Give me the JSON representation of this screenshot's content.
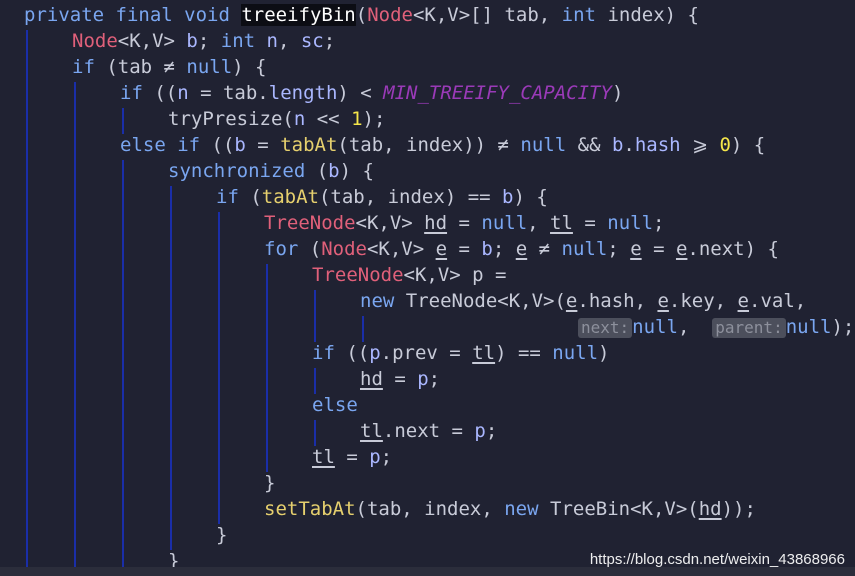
{
  "editor": {
    "language": "Java",
    "colors": {
      "background": "#202232",
      "keyword": "#7aa6f0",
      "type": "#e0607a",
      "method": "#e6d06e",
      "variable": "#aab7ff",
      "number": "#f5e64a",
      "constant": "#9a3ab8",
      "indent_guide": "#1a2ea8"
    },
    "lines": [
      {
        "tokens": [
          {
            "t": "private final void ",
            "c": "kw"
          },
          {
            "t": "treeifyBin",
            "c": "sel"
          },
          {
            "t": "(",
            "c": "plain"
          },
          {
            "t": "Node",
            "c": "tp"
          },
          {
            "t": "<K,V>[] tab, ",
            "c": "plain"
          },
          {
            "t": "int ",
            "c": "kw"
          },
          {
            "t": "index) {",
            "c": "plain"
          }
        ]
      },
      {
        "tokens": [
          {
            "t": "Node",
            "c": "tp"
          },
          {
            "t": "<K,V> ",
            "c": "plain"
          },
          {
            "t": "b",
            "c": "vr"
          },
          {
            "t": "; ",
            "c": "plain"
          },
          {
            "t": "int ",
            "c": "kw"
          },
          {
            "t": "n",
            "c": "vr"
          },
          {
            "t": ", ",
            "c": "plain"
          },
          {
            "t": "sc",
            "c": "vr"
          },
          {
            "t": ";",
            "c": "plain"
          }
        ]
      },
      {
        "tokens": [
          {
            "t": "if ",
            "c": "kw"
          },
          {
            "t": "(tab ≠ ",
            "c": "plain"
          },
          {
            "t": "null",
            "c": "kw"
          },
          {
            "t": ") {",
            "c": "plain"
          }
        ]
      },
      {
        "tokens": [
          {
            "t": "if ",
            "c": "kw"
          },
          {
            "t": "((",
            "c": "plain"
          },
          {
            "t": "n",
            "c": "vr"
          },
          {
            "t": " = tab.",
            "c": "plain"
          },
          {
            "t": "length",
            "c": "vr"
          },
          {
            "t": ") < ",
            "c": "plain"
          },
          {
            "t": "MIN_TREEIFY_CAPACITY",
            "c": "cst"
          },
          {
            "t": ")",
            "c": "plain"
          }
        ]
      },
      {
        "tokens": [
          {
            "t": "tryPresize(",
            "c": "plain"
          },
          {
            "t": "n",
            "c": "vr"
          },
          {
            "t": " << ",
            "c": "plain"
          },
          {
            "t": "1",
            "c": "num"
          },
          {
            "t": ");",
            "c": "plain"
          }
        ]
      },
      {
        "tokens": [
          {
            "t": "else if ",
            "c": "kw"
          },
          {
            "t": "((",
            "c": "plain"
          },
          {
            "t": "b",
            "c": "vr"
          },
          {
            "t": " = ",
            "c": "plain"
          },
          {
            "t": "tabAt",
            "c": "fn"
          },
          {
            "t": "(tab, index)) ≠ ",
            "c": "plain"
          },
          {
            "t": "null",
            "c": "kw"
          },
          {
            "t": " && ",
            "c": "plain"
          },
          {
            "t": "b",
            "c": "vr"
          },
          {
            "t": ".",
            "c": "plain"
          },
          {
            "t": "hash",
            "c": "vr"
          },
          {
            "t": " ⩾ ",
            "c": "plain"
          },
          {
            "t": "0",
            "c": "num"
          },
          {
            "t": ") {",
            "c": "plain"
          }
        ]
      },
      {
        "tokens": [
          {
            "t": "synchronized ",
            "c": "kw"
          },
          {
            "t": "(",
            "c": "plain"
          },
          {
            "t": "b",
            "c": "vr"
          },
          {
            "t": ") {",
            "c": "plain"
          }
        ]
      },
      {
        "tokens": [
          {
            "t": "if ",
            "c": "kw"
          },
          {
            "t": "(",
            "c": "plain"
          },
          {
            "t": "tabAt",
            "c": "fn"
          },
          {
            "t": "(tab, index) == ",
            "c": "plain"
          },
          {
            "t": "b",
            "c": "vr"
          },
          {
            "t": ") {",
            "c": "plain"
          }
        ]
      },
      {
        "tokens": [
          {
            "t": "TreeNode",
            "c": "tp"
          },
          {
            "t": "<K,V> ",
            "c": "plain"
          },
          {
            "t": "hd",
            "c": "plain",
            "u": true
          },
          {
            "t": " = ",
            "c": "plain"
          },
          {
            "t": "null",
            "c": "kw"
          },
          {
            "t": ", ",
            "c": "plain"
          },
          {
            "t": "tl",
            "c": "plain",
            "u": true
          },
          {
            "t": " = ",
            "c": "plain"
          },
          {
            "t": "null",
            "c": "kw"
          },
          {
            "t": ";",
            "c": "plain"
          }
        ]
      },
      {
        "tokens": [
          {
            "t": "for ",
            "c": "kw"
          },
          {
            "t": "(",
            "c": "plain"
          },
          {
            "t": "Node",
            "c": "tp"
          },
          {
            "t": "<K,V> ",
            "c": "plain"
          },
          {
            "t": "e",
            "c": "plain",
            "u": true
          },
          {
            "t": " = ",
            "c": "plain"
          },
          {
            "t": "b",
            "c": "vr"
          },
          {
            "t": "; ",
            "c": "plain"
          },
          {
            "t": "e",
            "c": "plain",
            "u": true
          },
          {
            "t": " ≠ ",
            "c": "plain"
          },
          {
            "t": "null",
            "c": "kw"
          },
          {
            "t": "; ",
            "c": "plain"
          },
          {
            "t": "e",
            "c": "plain",
            "u": true
          },
          {
            "t": " = ",
            "c": "plain"
          },
          {
            "t": "e",
            "c": "plain",
            "u": true
          },
          {
            "t": ".next) {",
            "c": "plain"
          }
        ]
      },
      {
        "tokens": [
          {
            "t": "TreeNode",
            "c": "tp"
          },
          {
            "t": "<K,V> p =",
            "c": "plain"
          }
        ]
      },
      {
        "tokens": [
          {
            "t": "new ",
            "c": "kw"
          },
          {
            "t": "TreeNode<K,V>(",
            "c": "plain"
          },
          {
            "t": "e",
            "c": "plain",
            "u": true
          },
          {
            "t": ".hash, ",
            "c": "plain"
          },
          {
            "t": "e",
            "c": "plain",
            "u": true
          },
          {
            "t": ".key, ",
            "c": "plain"
          },
          {
            "t": "e",
            "c": "plain",
            "u": true
          },
          {
            "t": ".val,",
            "c": "plain"
          }
        ]
      },
      {
        "tokens": [
          {
            "t": "next:",
            "c": "hint"
          },
          {
            "t": "null",
            "c": "kw"
          },
          {
            "t": ",  ",
            "c": "plain"
          },
          {
            "t": "parent:",
            "c": "hint"
          },
          {
            "t": "null",
            "c": "kw"
          },
          {
            "t": ");",
            "c": "plain"
          }
        ]
      },
      {
        "tokens": [
          {
            "t": "if ",
            "c": "kw"
          },
          {
            "t": "((",
            "c": "plain"
          },
          {
            "t": "p",
            "c": "vr"
          },
          {
            "t": ".prev = ",
            "c": "plain"
          },
          {
            "t": "tl",
            "c": "plain",
            "u": true
          },
          {
            "t": ") == ",
            "c": "plain"
          },
          {
            "t": "null",
            "c": "kw"
          },
          {
            "t": ")",
            "c": "plain"
          }
        ]
      },
      {
        "tokens": [
          {
            "t": "hd",
            "c": "plain",
            "u": true
          },
          {
            "t": " = ",
            "c": "plain"
          },
          {
            "t": "p",
            "c": "vr"
          },
          {
            "t": ";",
            "c": "plain"
          }
        ]
      },
      {
        "tokens": [
          {
            "t": "else",
            "c": "kw"
          }
        ]
      },
      {
        "tokens": [
          {
            "t": "tl",
            "c": "plain",
            "u": true
          },
          {
            "t": ".next = ",
            "c": "plain"
          },
          {
            "t": "p",
            "c": "vr"
          },
          {
            "t": ";",
            "c": "plain"
          }
        ]
      },
      {
        "tokens": [
          {
            "t": "tl",
            "c": "plain",
            "u": true
          },
          {
            "t": " = ",
            "c": "plain"
          },
          {
            "t": "p",
            "c": "vr"
          },
          {
            "t": ";",
            "c": "plain"
          }
        ]
      },
      {
        "tokens": [
          {
            "t": "}",
            "c": "plain"
          }
        ]
      },
      {
        "tokens": [
          {
            "t": "setTabAt",
            "c": "fn"
          },
          {
            "t": "(tab, index, ",
            "c": "plain"
          },
          {
            "t": "new ",
            "c": "kw"
          },
          {
            "t": "TreeBin<K,V>(",
            "c": "plain"
          },
          {
            "t": "hd",
            "c": "plain",
            "u": true
          },
          {
            "t": "));",
            "c": "plain"
          }
        ]
      },
      {
        "tokens": [
          {
            "t": "}",
            "c": "plain"
          }
        ]
      },
      {
        "tokens": [
          {
            "t": "}",
            "c": "plain"
          }
        ]
      }
    ]
  },
  "watermark": "https://blog.csdn.net/weixin_43868966"
}
